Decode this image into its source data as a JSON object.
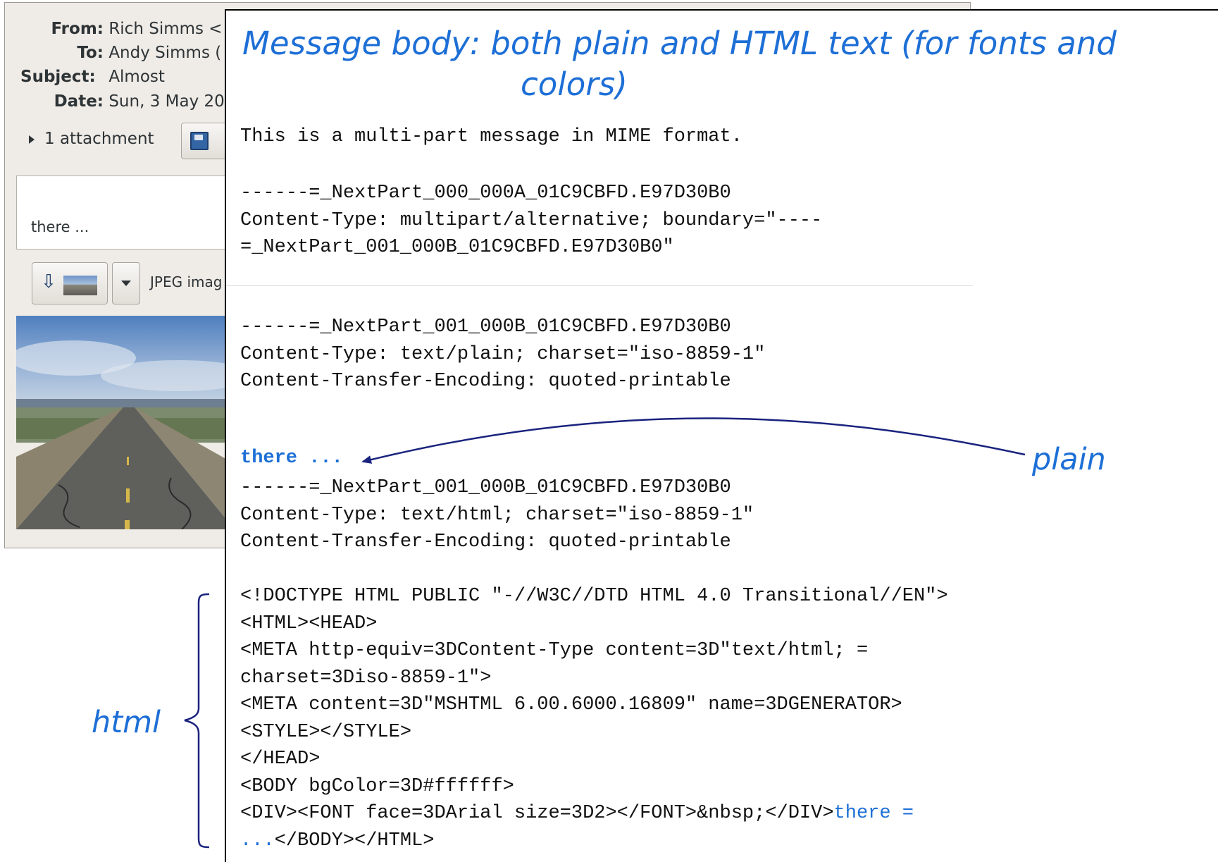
{
  "mail": {
    "headers": {
      "from_label": "From:",
      "from_value": "Rich Simms <",
      "to_label": "To:",
      "to_value": "Andy Simms (",
      "subject_label": "Subject:",
      "subject_value": "Almost",
      "date_label": "Date:",
      "date_value": "Sun, 3 May 20"
    },
    "attachment_summary": "1 attachment",
    "body_preview": "there ...",
    "attachment_type": "JPEG imag",
    "icons": {
      "expander": "triangle-right-icon",
      "save": "floppy-disk-icon",
      "open": "down-arrow-icon",
      "thumbnail": "image-thumbnail-icon",
      "menu": "chevron-down-icon"
    }
  },
  "panel": {
    "title_line1": "Message body:  both plain and HTML text (for fonts and",
    "title_line2": "colors)",
    "intro": "This is a multi-part message in MIME format.",
    "multipart_block": "------=_NextPart_000_000A_01C9CBFD.E97D30B0\nContent-Type: multipart/alternative; boundary=\"----\n=_NextPart_001_000B_01C9CBFD.E97D30B0\"",
    "plain_header_block": "------=_NextPart_001_000B_01C9CBFD.E97D30B0\nContent-Type: text/plain; charset=\"iso-8859-1\"\nContent-Transfer-Encoding: quoted-printable",
    "plain_body": "there ...",
    "html_header_block": "------=_NextPart_001_000B_01C9CBFD.E97D30B0\nContent-Type: text/html; charset=\"iso-8859-1\"\nContent-Transfer-Encoding: quoted-printable",
    "html_source_lines": [
      "<!DOCTYPE HTML PUBLIC \"-//W3C//DTD HTML 4.0 Transitional//EN\">",
      "<HTML><HEAD>",
      "<META http-equiv=3DContent-Type content=3D\"text/html; =",
      "charset=3Diso-8859-1\">",
      "<META content=3D\"MSHTML 6.00.6000.16809\" name=3DGENERATOR>",
      "<STYLE></STYLE>",
      "</HEAD>",
      "<BODY bgColor=3D#ffffff>"
    ],
    "html_div_line_prefix": "<DIV><FONT face=3DArial size=3D2></FONT>&nbsp;</DIV>",
    "html_div_line_highlight": "there =",
    "html_last_line_highlight": "...",
    "html_last_line_suffix": "</BODY></HTML>"
  },
  "annotations": {
    "plain": "plain",
    "html": "html",
    "accent_color": "#1d6fd6",
    "arrow_color": "#1a237e"
  }
}
